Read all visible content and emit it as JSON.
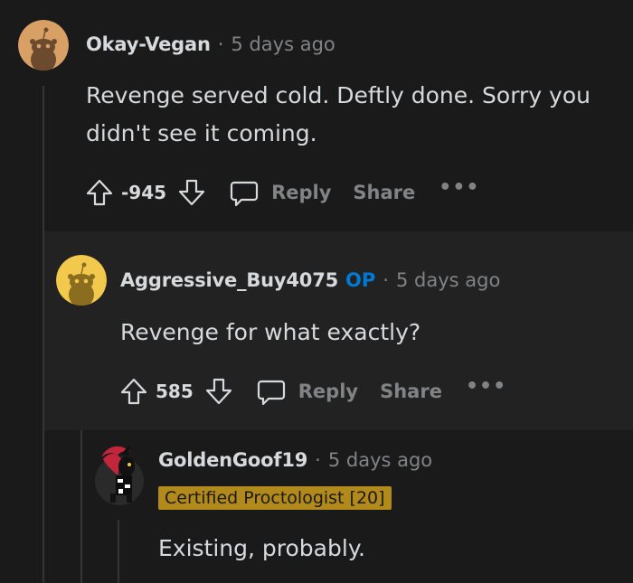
{
  "comments": [
    {
      "username": "Okay-Vegan",
      "separator": "·",
      "time": "5 days ago",
      "text_lines": [
        "Revenge served cold. Deftly done. Sorry you",
        "didn't see it coming."
      ],
      "score": "-945",
      "reply_label": "Reply",
      "share_label": "Share",
      "more_label": "•••"
    },
    {
      "username": "Aggressive_Buy4075",
      "op_label": "OP",
      "separator": "·",
      "time": "5 days ago",
      "text": "Revenge for what exactly?",
      "score": "585",
      "reply_label": "Reply",
      "share_label": "Share",
      "more_label": "•••"
    },
    {
      "username": "GoldenGoof19",
      "separator": "·",
      "time": "5 days ago",
      "flair": "Certified Proctologist [20]",
      "text": "Existing, probably."
    }
  ],
  "colors": {
    "background": "#1a1a1b",
    "nested_background": "#222223",
    "op_blue": "#0079d3",
    "flair_gold": "#b28a1b",
    "avatar_1": "#d9a066",
    "avatar_2": "#f2c94c"
  },
  "icons": [
    "snoo-avatar-icon",
    "upvote-icon",
    "downvote-icon",
    "comment-icon",
    "more-icon"
  ]
}
